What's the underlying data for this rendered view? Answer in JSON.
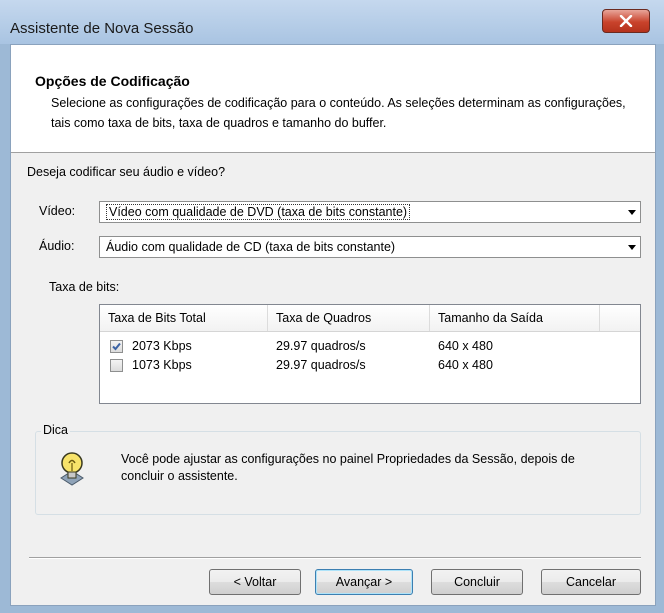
{
  "window": {
    "title": "Assistente de Nova Sessão"
  },
  "header": {
    "title": "Opções de Codificação",
    "description": "Selecione as configurações de codificação para o conteúdo. As seleções determinam as configurações, tais como taxa de bits, taxa de quadros e tamanho do buffer."
  },
  "question": "Deseja codificar seu áudio e vídeo?",
  "video": {
    "label": "Vídeo:",
    "selected": "Vídeo com qualidade de DVD (taxa de bits constante)"
  },
  "audio": {
    "label": "Áudio:",
    "selected": "Áudio com qualidade de CD (taxa de bits constante)"
  },
  "bitrate": {
    "label": "Taxa de bits:",
    "columns": [
      "Taxa de Bits Total",
      "Taxa de Quadros",
      "Tamanho da Saída"
    ],
    "rows": [
      {
        "checked": true,
        "bitrate": "2073 Kbps",
        "framerate": "29.97 quadros/s",
        "size": "640 x 480"
      },
      {
        "checked": false,
        "bitrate": "1073 Kbps",
        "framerate": "29.97 quadros/s",
        "size": "640 x 480"
      }
    ]
  },
  "tip": {
    "legend": "Dica",
    "text": "Você pode ajustar as configurações no painel Propriedades da Sessão, depois de concluir o assistente.",
    "icon": "lightbulb-icon"
  },
  "buttons": {
    "back": "< Voltar",
    "next": "Avançar >",
    "finish": "Concluir",
    "cancel": "Cancelar"
  },
  "colors": {
    "close_button": "#c9432c",
    "title_bar": "#a9c4e2",
    "client_bg": "#f0f0f0"
  }
}
